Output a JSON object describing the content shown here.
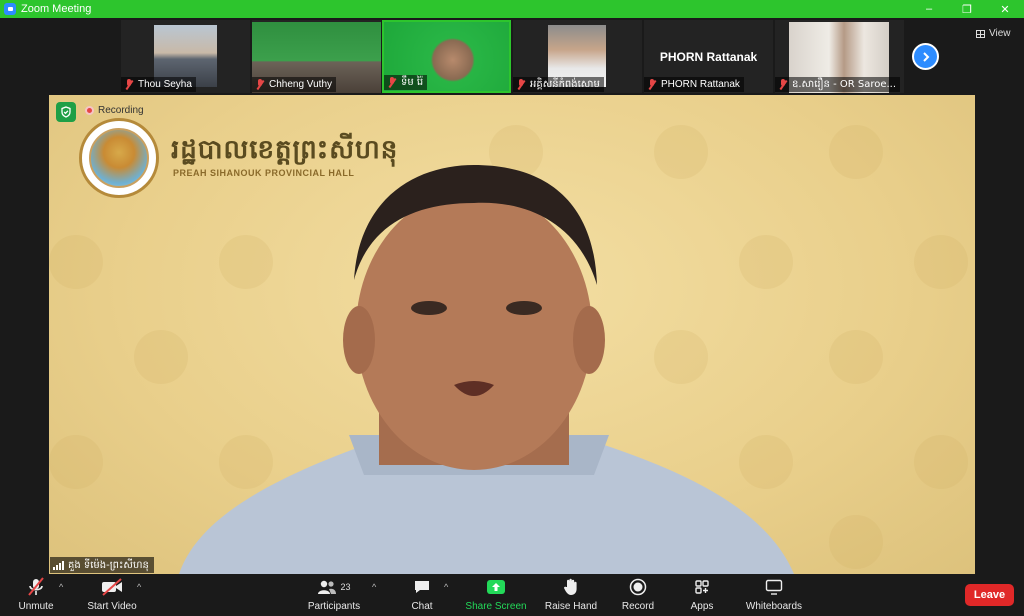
{
  "window": {
    "title": "Zoom Meeting",
    "minimize": "–",
    "maximize": "❐",
    "close": "✕"
  },
  "gallery": {
    "participants": [
      {
        "name": "Thou Seyha",
        "muted": true
      },
      {
        "name": "Chheng Vuthy",
        "muted": true
      },
      {
        "name": "ទឹម រ៉ៃ",
        "muted": true
      },
      {
        "name": "អគ្គិសនីកំពង់សោម",
        "muted": true
      },
      {
        "name": "PHORN Rattanak",
        "muted": true,
        "video_off": true
      },
      {
        "name": "ឧ.សារឿន - OR Saroe...",
        "muted": true
      }
    ],
    "view_label": "View"
  },
  "main": {
    "recording_label": "Recording",
    "hall_name_kh": "រដ្ឋបាលខេត្តព្រះសីហនុ",
    "hall_name_en": "PREAH SIHANOUK PROVINCIAL HALL",
    "speaker_name": "គួង ទីម៉េង-ព្រះសីហនុ"
  },
  "toolbar": {
    "unmute": "Unmute",
    "start_video": "Start Video",
    "participants": "Participants",
    "participants_count": "23",
    "chat": "Chat",
    "share_screen": "Share Screen",
    "raise_hand": "Raise Hand",
    "record": "Record",
    "apps": "Apps",
    "whiteboards": "Whiteboards",
    "leave": "Leave"
  },
  "colors": {
    "title_bar": "#2dc52d",
    "share_screen": "#23d959",
    "leave": "#e02828",
    "accent": "#2d8cff"
  }
}
